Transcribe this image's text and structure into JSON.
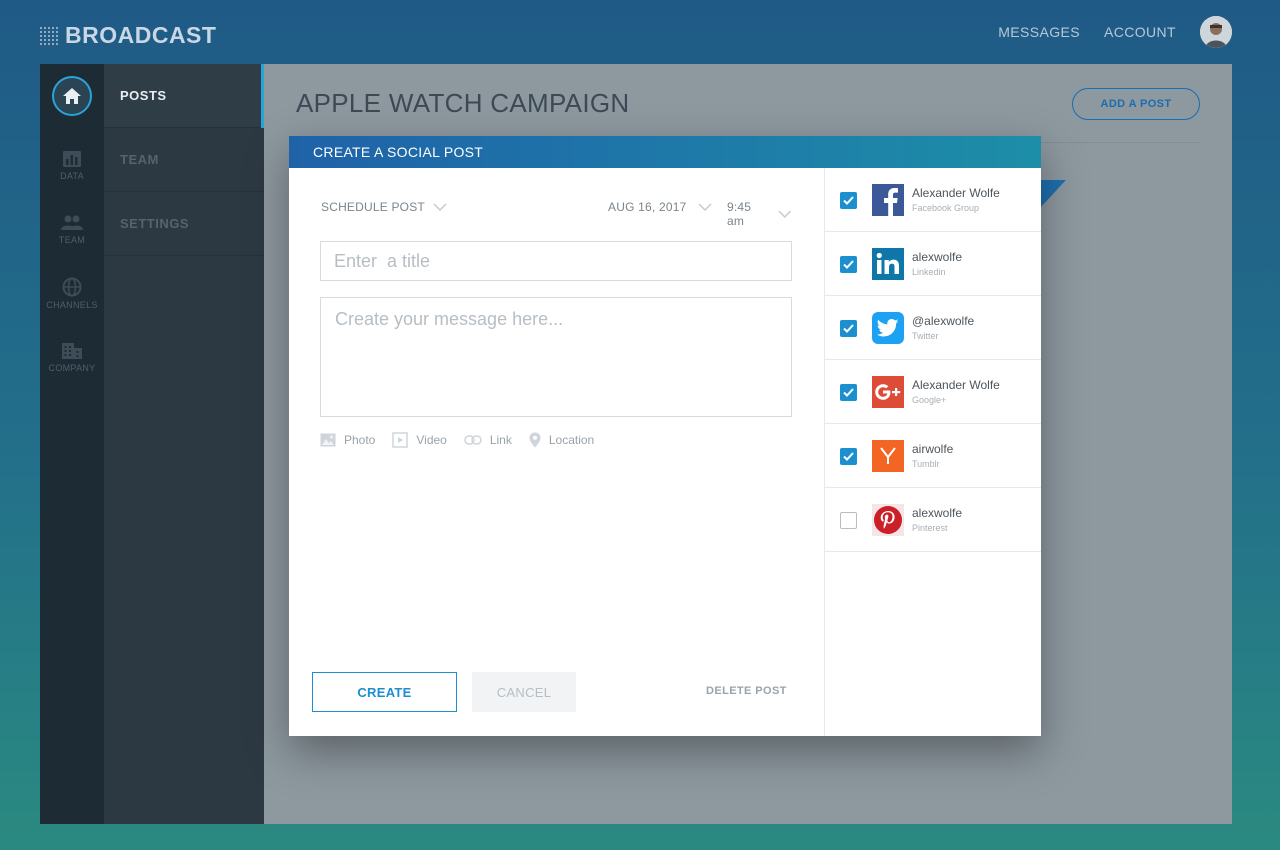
{
  "brand": {
    "name": "BROADCAST"
  },
  "top_nav": {
    "messages": "MESSAGES",
    "account": "ACCOUNT"
  },
  "rail": [
    {
      "icon": "home-icon",
      "label": ""
    },
    {
      "icon": "bar-chart-icon",
      "label": "DATA"
    },
    {
      "icon": "team-icon",
      "label": "TEAM"
    },
    {
      "icon": "globe-icon",
      "label": "CHANNELS"
    },
    {
      "icon": "building-icon",
      "label": "COMPANY"
    }
  ],
  "sub_nav": [
    {
      "label": "POSTS",
      "active": true
    },
    {
      "label": "TEAM",
      "active": false
    },
    {
      "label": "SETTINGS",
      "active": false
    }
  ],
  "page": {
    "title": "APPLE WATCH CAMPAIGN",
    "add_post": "ADD A POST"
  },
  "modal": {
    "title": "CREATE A SOCIAL POST",
    "schedule": {
      "label": "SCHEDULE POST",
      "date": "AUG 16, 2017",
      "time": "9:45 am"
    },
    "title_placeholder": "Enter  a title",
    "message_placeholder": "Create your message here...",
    "attachments": [
      {
        "icon": "photo-icon",
        "label": "Photo"
      },
      {
        "icon": "video-icon",
        "label": "Video"
      },
      {
        "icon": "link-icon",
        "label": "Link"
      },
      {
        "icon": "location-icon",
        "label": "Location"
      }
    ],
    "create": "CREATE",
    "cancel": "CANCEL",
    "delete": "DELETE POST"
  },
  "accounts": [
    {
      "name": "Alexander Wolfe",
      "type": "Facebook Group",
      "network": "facebook",
      "checked": true,
      "color": "#3b5998"
    },
    {
      "name": "alexwolfe",
      "type": "Linkedin",
      "network": "linkedin",
      "checked": true,
      "color": "#0e76a8"
    },
    {
      "name": "@alexwolfe",
      "type": "Twitter",
      "network": "twitter",
      "checked": true,
      "color": "#1da1f2"
    },
    {
      "name": "Alexander Wolfe",
      "type": "Google+",
      "network": "google-plus",
      "checked": true,
      "color": "#dd4b39"
    },
    {
      "name": "airwolfe",
      "type": "Tumblr",
      "network": "tumblr",
      "checked": true,
      "color": "#f26522"
    },
    {
      "name": "alexwolfe",
      "type": "Pinterest",
      "network": "pinterest",
      "checked": false,
      "color": "#cb2027"
    }
  ],
  "colors": {
    "accent": "#1c8fd1",
    "header_start": "#1f62a8",
    "header_end": "#1d8ea8"
  }
}
